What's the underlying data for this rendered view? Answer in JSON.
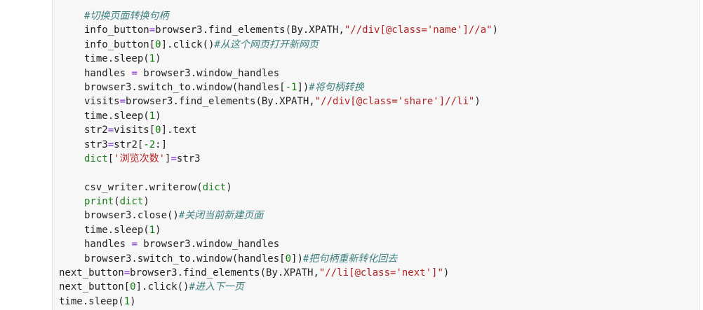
{
  "code_lines": [
    {
      "indent": 1,
      "tokens": [
        {
          "t": "#切换页面转换句柄",
          "c": "comment"
        }
      ]
    },
    {
      "indent": 1,
      "tokens": [
        {
          "t": "info_button",
          "c": "plain"
        },
        {
          "t": "=",
          "c": "op"
        },
        {
          "t": "browser3.find_elements(By.XPATH,",
          "c": "plain"
        },
        {
          "t": "\"//div[@class='name']//a\"",
          "c": "string"
        },
        {
          "t": ")",
          "c": "plain"
        }
      ]
    },
    {
      "indent": 1,
      "tokens": [
        {
          "t": "info_button[",
          "c": "plain"
        },
        {
          "t": "0",
          "c": "number"
        },
        {
          "t": "].click()",
          "c": "plain"
        },
        {
          "t": "#从这个网页打开新网页",
          "c": "comment"
        }
      ]
    },
    {
      "indent": 1,
      "tokens": [
        {
          "t": "time.sleep(",
          "c": "plain"
        },
        {
          "t": "1",
          "c": "number"
        },
        {
          "t": ")",
          "c": "plain"
        }
      ]
    },
    {
      "indent": 1,
      "tokens": [
        {
          "t": "handles ",
          "c": "plain"
        },
        {
          "t": "=",
          "c": "op"
        },
        {
          "t": " browser3.window_handles",
          "c": "plain"
        }
      ]
    },
    {
      "indent": 1,
      "tokens": [
        {
          "t": "browser3.switch_to.window(handles[",
          "c": "plain"
        },
        {
          "t": "-1",
          "c": "number"
        },
        {
          "t": "])",
          "c": "plain"
        },
        {
          "t": "#将句柄转换",
          "c": "comment"
        }
      ]
    },
    {
      "indent": 1,
      "tokens": [
        {
          "t": "visits",
          "c": "plain"
        },
        {
          "t": "=",
          "c": "op"
        },
        {
          "t": "browser3.find_elements(By.XPATH,",
          "c": "plain"
        },
        {
          "t": "\"//div[@class='share']//li\"",
          "c": "string"
        },
        {
          "t": ")",
          "c": "plain"
        }
      ]
    },
    {
      "indent": 1,
      "tokens": [
        {
          "t": "time.sleep(",
          "c": "plain"
        },
        {
          "t": "1",
          "c": "number"
        },
        {
          "t": ")",
          "c": "plain"
        }
      ]
    },
    {
      "indent": 1,
      "tokens": [
        {
          "t": "str2",
          "c": "plain"
        },
        {
          "t": "=",
          "c": "op"
        },
        {
          "t": "visits[",
          "c": "plain"
        },
        {
          "t": "0",
          "c": "number"
        },
        {
          "t": "].text",
          "c": "plain"
        }
      ]
    },
    {
      "indent": 1,
      "tokens": [
        {
          "t": "str3",
          "c": "plain"
        },
        {
          "t": "=",
          "c": "op"
        },
        {
          "t": "str2[",
          "c": "plain"
        },
        {
          "t": "-2",
          "c": "number"
        },
        {
          "t": ":]",
          "c": "plain"
        }
      ]
    },
    {
      "indent": 1,
      "tokens": [
        {
          "t": "dict",
          "c": "builtin"
        },
        {
          "t": "[",
          "c": "plain"
        },
        {
          "t": "'浏览次数'",
          "c": "string"
        },
        {
          "t": "]",
          "c": "plain"
        },
        {
          "t": "=",
          "c": "op"
        },
        {
          "t": "str3",
          "c": "plain"
        }
      ]
    },
    {
      "indent": 0,
      "tokens": []
    },
    {
      "indent": 1,
      "tokens": [
        {
          "t": "csv_writer.writerow(",
          "c": "plain"
        },
        {
          "t": "dict",
          "c": "builtin"
        },
        {
          "t": ")",
          "c": "plain"
        }
      ]
    },
    {
      "indent": 1,
      "tokens": [
        {
          "t": "print",
          "c": "builtin"
        },
        {
          "t": "(",
          "c": "plain"
        },
        {
          "t": "dict",
          "c": "builtin"
        },
        {
          "t": ")",
          "c": "plain"
        }
      ]
    },
    {
      "indent": 1,
      "tokens": [
        {
          "t": "browser3.close()",
          "c": "plain"
        },
        {
          "t": "#关闭当前新建页面",
          "c": "comment"
        }
      ]
    },
    {
      "indent": 1,
      "tokens": [
        {
          "t": "time.sleep(",
          "c": "plain"
        },
        {
          "t": "1",
          "c": "number"
        },
        {
          "t": ")",
          "c": "plain"
        }
      ]
    },
    {
      "indent": 1,
      "tokens": [
        {
          "t": "handles ",
          "c": "plain"
        },
        {
          "t": "=",
          "c": "op"
        },
        {
          "t": " browser3.window_handles",
          "c": "plain"
        }
      ]
    },
    {
      "indent": 1,
      "tokens": [
        {
          "t": "browser3.switch_to.window(handles[",
          "c": "plain"
        },
        {
          "t": "0",
          "c": "number"
        },
        {
          "t": "])",
          "c": "plain"
        },
        {
          "t": "#把句柄重新转化回去",
          "c": "comment"
        }
      ]
    },
    {
      "indent": 0,
      "tokens": [
        {
          "t": "next_button",
          "c": "plain"
        },
        {
          "t": "=",
          "c": "op"
        },
        {
          "t": "browser3.find_elements(By.XPATH,",
          "c": "plain"
        },
        {
          "t": "\"//li[@class='next']\"",
          "c": "string"
        },
        {
          "t": ")",
          "c": "plain"
        }
      ]
    },
    {
      "indent": 0,
      "tokens": [
        {
          "t": "next_button[",
          "c": "plain"
        },
        {
          "t": "0",
          "c": "number"
        },
        {
          "t": "].click()",
          "c": "plain"
        },
        {
          "t": "#进入下一页",
          "c": "comment"
        }
      ]
    },
    {
      "indent": 0,
      "tokens": [
        {
          "t": "time.sleep(",
          "c": "plain"
        },
        {
          "t": "1",
          "c": "number"
        },
        {
          "t": ")",
          "c": "plain"
        }
      ]
    }
  ]
}
